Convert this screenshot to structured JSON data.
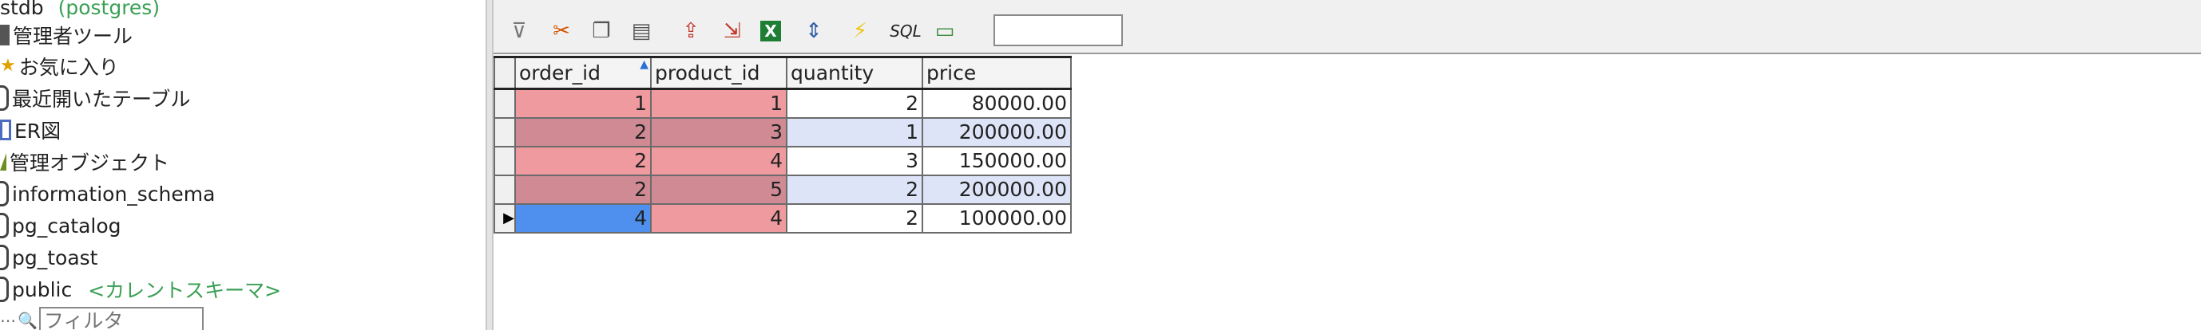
{
  "tree": {
    "connection": {
      "name": "stdb",
      "engine": "(postgres)"
    },
    "items": [
      {
        "label": "管理者ツール",
        "icon": "admin-tools-icon"
      },
      {
        "label": "お気に入り",
        "icon": "star-icon"
      },
      {
        "label": "最近開いたテーブル",
        "icon": "recent-tables-icon"
      },
      {
        "label": "ER図",
        "icon": "er-diagram-icon"
      },
      {
        "label": "管理オブジェクト",
        "icon": "managed-objects-icon"
      },
      {
        "label": "information_schema",
        "icon": "schema-icon"
      },
      {
        "label": "pg_catalog",
        "icon": "schema-icon"
      },
      {
        "label": "pg_toast",
        "icon": "schema-icon"
      },
      {
        "label": "public",
        "icon": "schema-icon",
        "tag": "<カレントスキーマ>"
      }
    ],
    "filter_placeholder": "フィルタ"
  },
  "toolbar": {
    "buttons": [
      {
        "name": "filter-icon",
        "glyph": "⊽"
      },
      {
        "name": "cut-icon",
        "glyph": "✂"
      },
      {
        "name": "copy-icon",
        "glyph": "❐"
      },
      {
        "name": "paste-icon",
        "glyph": "📋"
      },
      {
        "name": "export-icon",
        "glyph": "⇪"
      },
      {
        "name": "import-icon",
        "glyph": "⇲"
      },
      {
        "name": "excel-icon",
        "glyph": "X"
      },
      {
        "name": "column-settings-icon",
        "glyph": "⇕"
      },
      {
        "name": "execute-icon",
        "glyph": "⚡"
      },
      {
        "name": "sql-icon",
        "glyph": "SQL"
      },
      {
        "name": "comment-icon",
        "glyph": "💬"
      }
    ],
    "search_value": ""
  },
  "grid": {
    "columns": [
      "order_id",
      "product_id",
      "quantity",
      "price"
    ],
    "rows": [
      [
        "1",
        "1",
        "2",
        "80000.00"
      ],
      [
        "2",
        "3",
        "1",
        "200000.00"
      ],
      [
        "2",
        "4",
        "3",
        "150000.00"
      ],
      [
        "2",
        "5",
        "2",
        "200000.00"
      ],
      [
        "4",
        "4",
        "2",
        "100000.00"
      ]
    ],
    "current_row_index": 4,
    "colors": {
      "pk": "#ef9a9e",
      "pk_alt": "#cf8a94",
      "alt_row": "#dde4f8",
      "selected": "#4f90ee"
    }
  }
}
